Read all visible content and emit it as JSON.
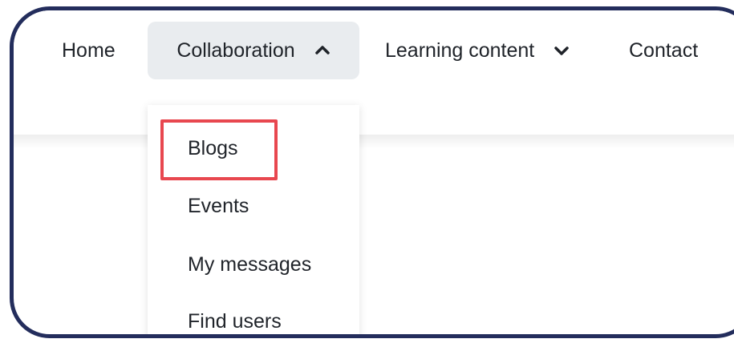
{
  "nav": {
    "home": "Home",
    "collaboration": "Collaboration",
    "learning_content": "Learning content",
    "contact": "Contact"
  },
  "dropdown": {
    "items": [
      "Blogs",
      "Events",
      "My messages",
      "Find users"
    ],
    "highlighted_item": "Blogs"
  },
  "icons": {
    "collaboration_chevron": "chevron-up-icon",
    "learning_chevron": "chevron-down-icon"
  },
  "colors": {
    "frame_border": "#232d5c",
    "active_tab_bg": "#e9ecef",
    "highlight": "#e8474f",
    "text": "#1f2329"
  }
}
